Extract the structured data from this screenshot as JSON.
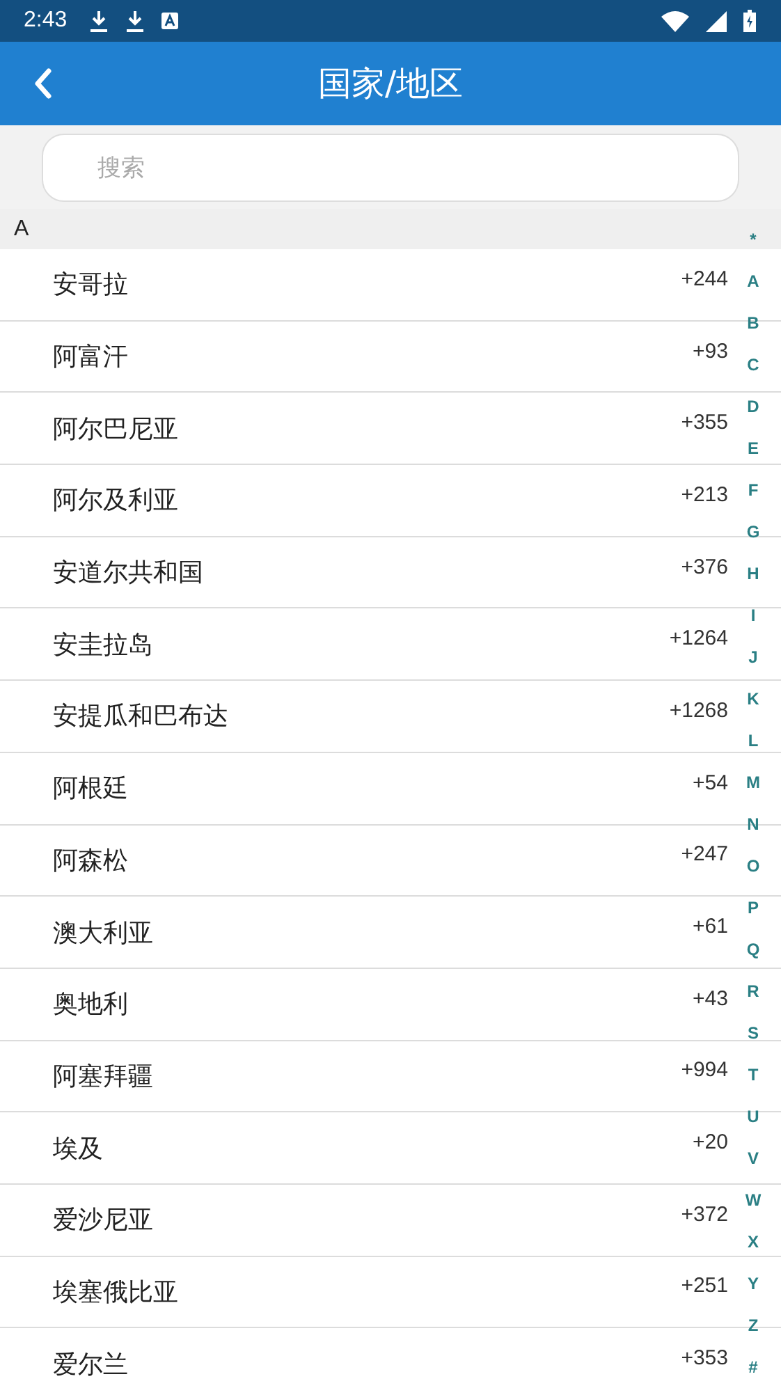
{
  "status_bar": {
    "time": "2:43"
  },
  "header": {
    "title": "国家/地区"
  },
  "search": {
    "placeholder": "搜索"
  },
  "section": {
    "letter": "A"
  },
  "countries": [
    {
      "name": "安哥拉",
      "code": "+244"
    },
    {
      "name": "阿富汗",
      "code": "+93"
    },
    {
      "name": "阿尔巴尼亚",
      "code": "+355"
    },
    {
      "name": "阿尔及利亚",
      "code": "+213"
    },
    {
      "name": "安道尔共和国",
      "code": "+376"
    },
    {
      "name": "安圭拉岛",
      "code": "+1264"
    },
    {
      "name": "安提瓜和巴布达",
      "code": "+1268"
    },
    {
      "name": "阿根廷",
      "code": "+54"
    },
    {
      "name": "阿森松",
      "code": "+247"
    },
    {
      "name": "澳大利亚",
      "code": "+61"
    },
    {
      "name": "奥地利",
      "code": "+43"
    },
    {
      "name": "阿塞拜疆",
      "code": "+994"
    },
    {
      "name": "埃及",
      "code": "+20"
    },
    {
      "name": "爱沙尼亚",
      "code": "+372"
    },
    {
      "name": "埃塞俄比亚",
      "code": "+251"
    },
    {
      "name": "爱尔兰",
      "code": "+353"
    }
  ],
  "index": [
    "*",
    "A",
    "B",
    "C",
    "D",
    "E",
    "F",
    "G",
    "H",
    "I",
    "J",
    "K",
    "L",
    "M",
    "N",
    "O",
    "P",
    "Q",
    "R",
    "S",
    "T",
    "U",
    "V",
    "W",
    "X",
    "Y",
    "Z",
    "#"
  ]
}
